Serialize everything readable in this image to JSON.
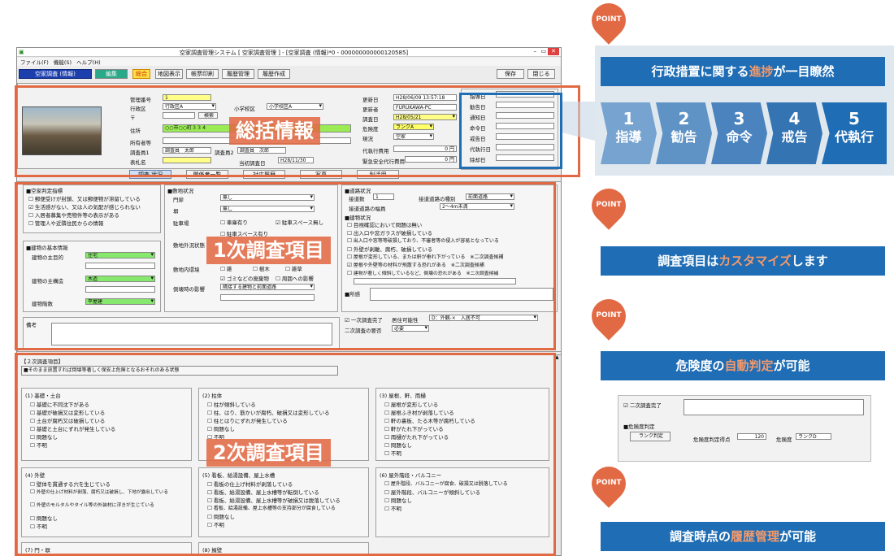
{
  "window": {
    "title": "空家調査管理システム [ 空家調査管理 ] - [空家調査 (情報)*0 - 000000000000120585]",
    "menu": [
      "ファイル(F)",
      "機能(S)",
      "ヘルプ(H)"
    ],
    "controls": [
      "–",
      "▭",
      "✕"
    ]
  },
  "toolbar": {
    "form_title": "空家調査 (情報)",
    "edit": "編集",
    "combined": "総合",
    "map": "地図表示",
    "print": "帳票印刷",
    "history_mgmt": "履歴管理",
    "history_create": "履歴作成",
    "save": "保存",
    "close": "閉じる"
  },
  "summary": {
    "fields": {
      "mgmt_no_label": "管理番号",
      "mgmt_no": "1",
      "ward_label": "行政区",
      "ward": "行政区A",
      "school_label": "小学校区",
      "school": "小学校区A",
      "postal_label": "〒",
      "search": "検索",
      "address_label": "住所",
      "address": "○○市○○町３３４",
      "owner_label": "所有者等",
      "surveyor_label": "調査員1",
      "surveyor1": "調査員　太郎",
      "surveyor2_label": "調査員2",
      "surveyor2": "調査員　次郎",
      "nameplate_label": "表札名",
      "first_survey_label": "当初調査日",
      "first_survey": "H28/11/30",
      "updated_label": "更新日",
      "updated": "H28/06/09 13:57:18",
      "updater_label": "更新者",
      "updater": "FURUKAWA-PC",
      "survey_date_label": "調査日",
      "survey_date": "H28/05/21",
      "risk_label": "危険度",
      "risk": "ランクA",
      "status_label": "現況",
      "status": "空家",
      "cost_label": "代執行費用",
      "cost": "0 円",
      "emergency_label": "緊急安全代行費用",
      "emergency": "0 円"
    },
    "steps_labels": [
      "指導日",
      "勧告日",
      "通知日",
      "命令日",
      "戒告日",
      "代執行日",
      "除却日"
    ],
    "tabs": [
      "調査 状況",
      "関係者一覧",
      "対応履歴",
      "写真",
      "利活用"
    ]
  },
  "survey1": {
    "vacancy_title": "■空家判定指標",
    "vacancy": [
      "郵便受けが封鎖、又は郵便物が滞留している",
      "生活感がない、又は人の気配が感じられない",
      "入居者募集や売物件等の表示がある",
      "管理人や近隣住民からの情報"
    ],
    "vacancy_checked": [
      false,
      true,
      false,
      false
    ],
    "building_title": "■建物の基本情報",
    "use_label": "建物の主目的",
    "use": "住宅",
    "struct_label": "建物の主構造",
    "struct": "木造",
    "floors_label": "建物階数",
    "floors": "平屋建",
    "site_title": "■敷地状況",
    "gate_label": "門扉",
    "gate": "無し",
    "fence_label": "塀",
    "fence": "無し",
    "parking_label": "駐車場",
    "parking": [
      "車庫有り",
      "駐車スペース無し",
      "駐車スペース有り"
    ],
    "env_label": "敷地外況状態",
    "inner_label": "敷地内環境",
    "inner": [
      "雑",
      "樹木",
      "雑草"
    ],
    "garbage": [
      "ゴミなどの廃棄物",
      "周囲への影響"
    ],
    "collapse_label": "倒壊時の影響",
    "collapse": "隣接する建物と前面道路",
    "road_title": "■道路状況",
    "road_count_label": "接道数",
    "road_count": "1",
    "road_type_label": "接道道路の種別",
    "road_type": "前面道路",
    "road_width_label": "接道道路の幅員",
    "road_width": "2～4m未満",
    "building_state_title": "■建物状況",
    "building_state": [
      "目視確認において問題は無い",
      "出入口や窓ガラスが破損している",
      "出入口や窓等等破損しており、不審者等の侵入が容易となっている",
      "外壁が剥離、腐朽、破損している",
      "屋根が変形している、または軒が垂れ下がっている　※二次調査候補",
      "屋根や外壁等の材料が飛散する恐れがある　※二次調査候補",
      "建物が著しく傾斜しているなど、倒壊の恐れがある　※二次調査候補"
    ],
    "building_state_checked": [
      false,
      false,
      false,
      false,
      false,
      true,
      false
    ],
    "notes_label": "■所感",
    "done": "一次調査完了",
    "eval_label": "居住可能性",
    "eval": "D：外観-×　入居不可",
    "need_label": "二次調査の要否",
    "need": "必要",
    "remark_label": "備考"
  },
  "survey2": {
    "header": "【２次調査項目】",
    "alert": "■そのまま放置すれば倒壊等著しく保安上危険となるおそれのある状態",
    "groups": [
      {
        "title": "(1) 基礎・土台",
        "items": [
          "基礎に不同沈下がある",
          "基礎が破損又は変形している",
          "土台が腐朽又は破損している",
          "基礎と土台にずれが発生している",
          "問題なし",
          "不明"
        ]
      },
      {
        "title": "(2) 柱体",
        "items": [
          "柱が傾斜している",
          "柱、はり、筋かいが腐朽、破損又は変形している",
          "柱とはりにずれが発生している",
          "問題なし",
          "不明"
        ]
      },
      {
        "title": "(3) 屋根、軒、雨樋",
        "items": [
          "屋根が変形している",
          "屋根ふき材が剥落している",
          "軒の裏板、たる木等が腐朽している",
          "軒がたれ下がっている",
          "雨樋がたれ下がっている",
          "問題なし",
          "不明"
        ]
      },
      {
        "title": "(4) 外壁",
        "items": [
          "壁体を貫通する穴を生じている",
          "外壁の仕上げ材料が剥落、腐朽又は破損し、下地が露出している",
          "外壁のモルタルやタイル等の外装材に浮きが生じている",
          "問題なし",
          "不明"
        ]
      },
      {
        "title": "(5) 看板、給湯設備、屋上水槽",
        "items": [
          "看板の仕上げ材料が剥落している",
          "看板、給湯設備、屋上水槽等が転倒している",
          "看板、給湯設備、屋上水槽等が破損又は脱落している",
          "看板、給湯設備、屋上水槽等の支持部分が腐食している",
          "問題なし",
          "不明"
        ]
      },
      {
        "title": "(6) 屋外階段・バルコニー",
        "items": [
          "屋外階段、バルコニーが腐食、破損又は脱落している",
          "屋外階段、バルコニーが傾斜している",
          "問題なし",
          "不明"
        ]
      },
      {
        "title": "(7) 門・塀",
        "items": []
      },
      {
        "title": "(8) 擁壁",
        "items": []
      }
    ]
  },
  "overlays": {
    "summary": "総括情報",
    "survey1": "1次調査項目",
    "survey2": "2次調査項目"
  },
  "points": [
    {
      "pin": "POINT",
      "pre": "行政措置に関する",
      "hl": "進捗",
      "post": "が一目瞭然"
    },
    {
      "pin": "POINT",
      "pre": "調査項目は",
      "hl": "カスタマイズ",
      "post": "します"
    },
    {
      "pin": "POINT",
      "pre": "危険度の",
      "hl": "自動判定",
      "post": "が可能"
    },
    {
      "pin": "POINT",
      "pre": "調査時点の",
      "hl": "履歴管理",
      "post": "が可能"
    }
  ],
  "steps": [
    {
      "n": "1",
      "w": "指導"
    },
    {
      "n": "2",
      "w": "勧告"
    },
    {
      "n": "3",
      "w": "命令"
    },
    {
      "n": "4",
      "w": "戒告"
    },
    {
      "n": "5",
      "w": "代執行"
    }
  ],
  "inset": {
    "done": "二次調査完了",
    "risk_title": "■危険度判定",
    "rank_button": "ランク判定",
    "score_label": "危険度判定得点",
    "score": "120",
    "risk_label": "危険度",
    "risk": "ランクD"
  },
  "colors": {
    "accent": "#e16a44",
    "banner": "#1e6db5",
    "step": "#76a3cf",
    "highlight": "#f59a6a"
  }
}
